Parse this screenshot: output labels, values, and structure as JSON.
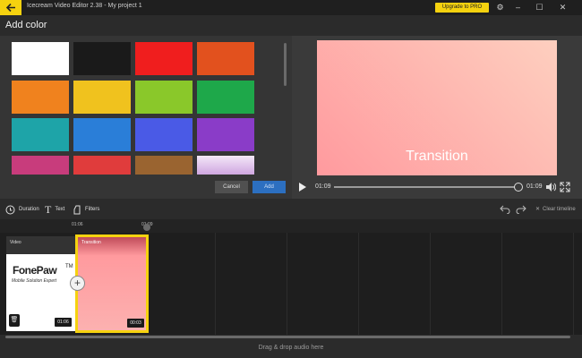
{
  "app": {
    "title": "Icecream Video Editor 2.38  -  My project 1",
    "upgrade_label": "Upgrade to PRO",
    "accent": "#f5d20f"
  },
  "header": {
    "title": "Add color"
  },
  "colors": [
    "#ffffff",
    "#1a1a1a",
    "#f01e1e",
    "#e2511e",
    "#f0821e",
    "#f0c21e",
    "#8ac82a",
    "#1ea84a",
    "#1ea4a8",
    "#2a7ed8",
    "#4a5ae6",
    "#8a3cc8",
    "#c83c7c",
    "#e03c3c",
    "#9a6430",
    "#e8c8f0"
  ],
  "actions": {
    "cancel": "Cancel",
    "add": "Add"
  },
  "preview": {
    "text": "Transition",
    "time_start": "01:09",
    "time_end": "01:09",
    "progress": 1.0
  },
  "toolbar": {
    "duration": "Duration",
    "text": "Text",
    "filters": "Filters",
    "clear_timeline": "Clear timeline"
  },
  "timeline": {
    "marks": [
      "01:06",
      "01:09"
    ],
    "clips": [
      {
        "label": "Video",
        "duration": "01:06",
        "logo": "FonePaw",
        "tm": "TM",
        "tagline": "Mobile Solution Expert"
      },
      {
        "label": "Transition",
        "duration": "00:03"
      }
    ],
    "audio_drop": "Drag & drop audio here"
  }
}
